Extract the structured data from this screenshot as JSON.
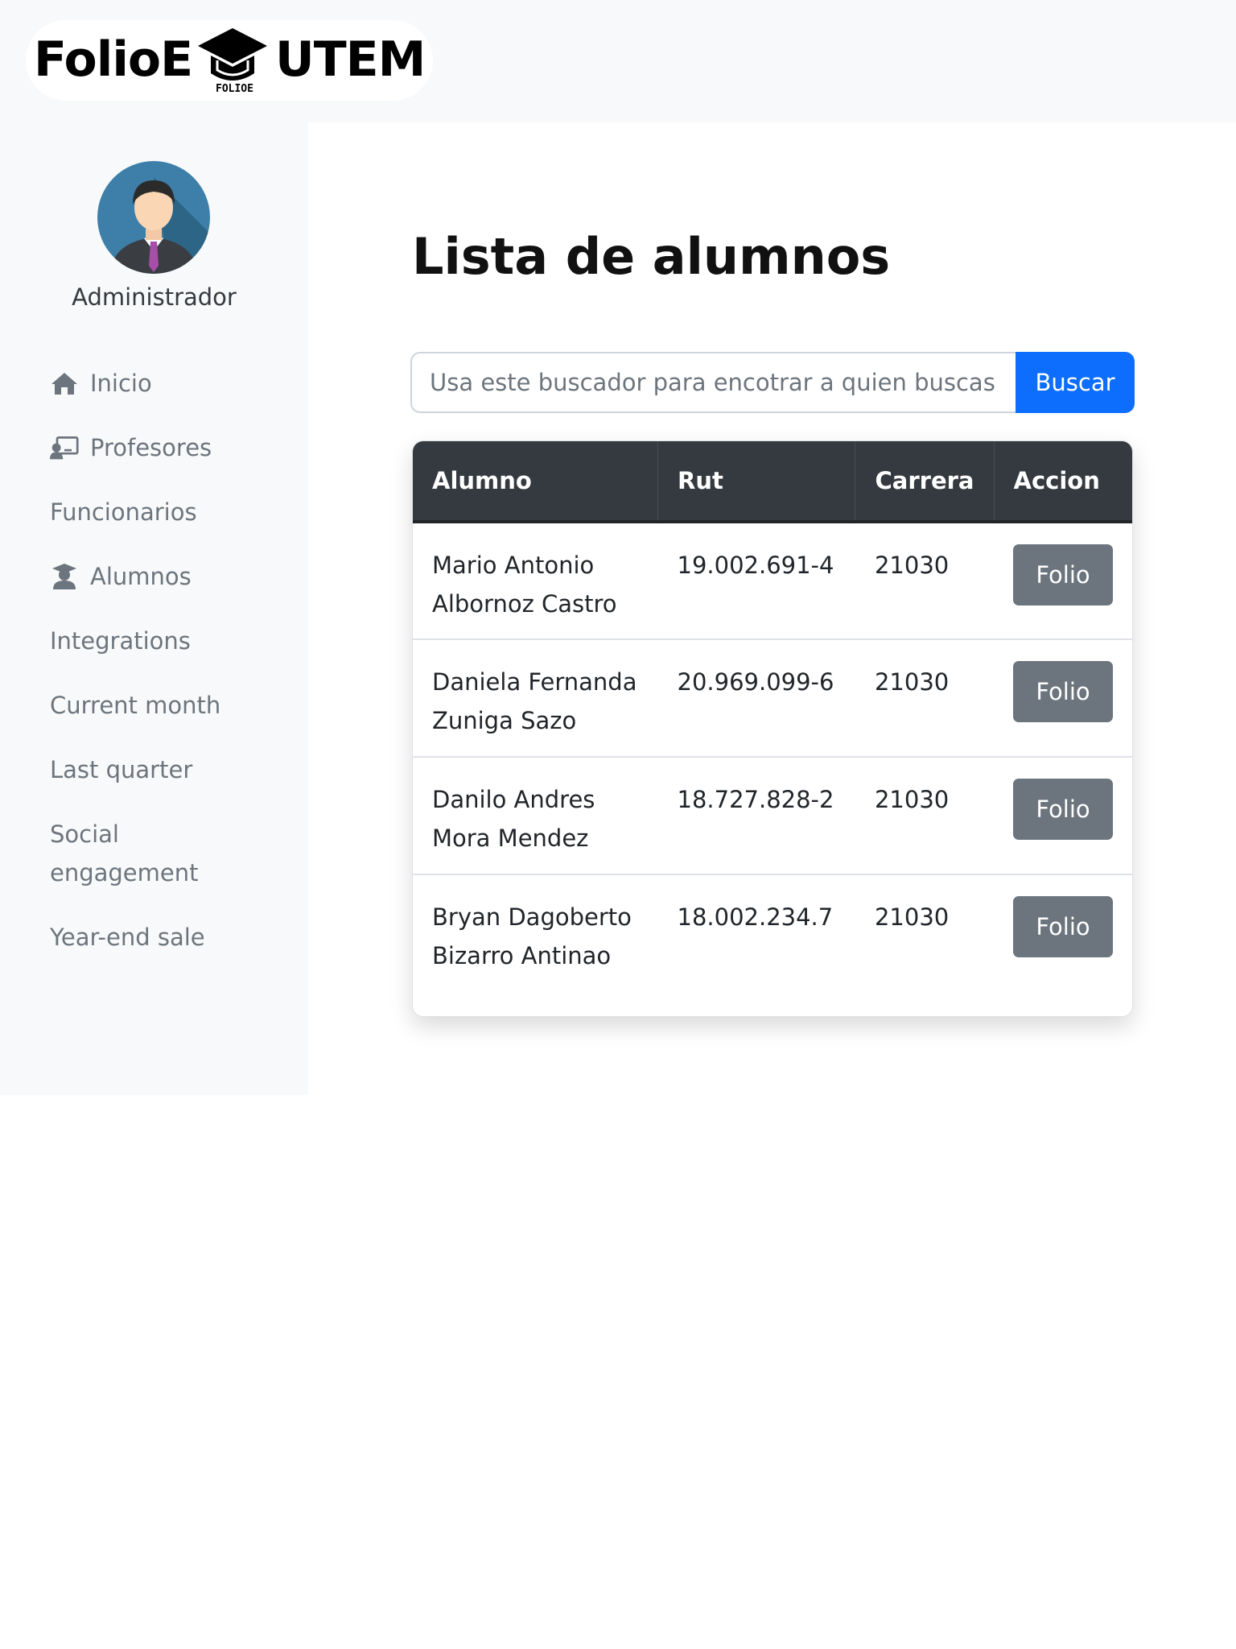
{
  "header": {
    "logo_left": "FolioE",
    "logo_right": "UTEM",
    "logo_small": "FOLIOE"
  },
  "sidebar": {
    "user_name": "Administrador",
    "items": [
      {
        "label": "Inicio",
        "icon": "home-icon"
      },
      {
        "label": "Profesores",
        "icon": "chalkboard-teacher-icon"
      },
      {
        "label": "Funcionarios",
        "icon": ""
      },
      {
        "label": "Alumnos",
        "icon": "user-graduate-icon"
      },
      {
        "label": "Integrations",
        "icon": ""
      },
      {
        "label": "Current month",
        "icon": ""
      },
      {
        "label": "Last quarter",
        "icon": ""
      },
      {
        "label": "Social engagement",
        "icon": ""
      },
      {
        "label": "Year-end sale",
        "icon": ""
      }
    ]
  },
  "main": {
    "title": "Lista de alumnos",
    "search": {
      "placeholder": "Usa este buscador para encotrar a quien buscas (E",
      "button_label": "Buscar"
    },
    "table": {
      "headers": [
        "Alumno",
        "Rut",
        "Carrera",
        "Accion"
      ],
      "rows": [
        {
          "alumno": "Mario Antonio Albornoz Castro",
          "rut": "19.002.691-4",
          "carrera": "21030",
          "accion": "Folio"
        },
        {
          "alumno": "Daniela Fernanda Zuniga Sazo",
          "rut": "20.969.099-6",
          "carrera": "21030",
          "accion": "Folio"
        },
        {
          "alumno": "Danilo Andres Mora Mendez",
          "rut": "18.727.828-2",
          "carrera": "21030",
          "accion": "Folio"
        },
        {
          "alumno": "Bryan Dagoberto Bizarro Antinao",
          "rut": "18.002.234.7",
          "carrera": "21030",
          "accion": "Folio"
        }
      ]
    }
  },
  "colors": {
    "primary": "#0d6efd",
    "secondary": "#6c757d",
    "table_header": "#343a40",
    "sidebar_bg": "#f8f9fa"
  }
}
